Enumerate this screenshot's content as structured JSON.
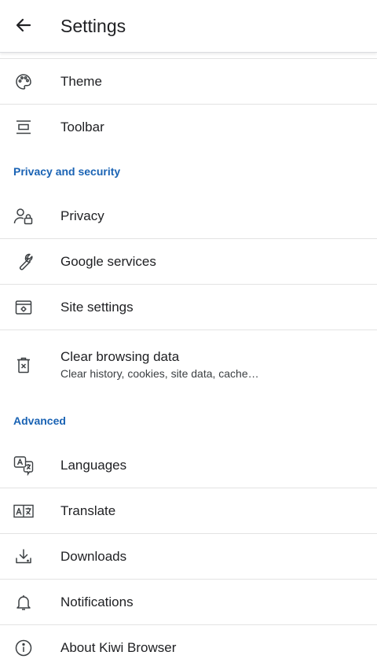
{
  "appbar": {
    "title": "Settings",
    "back_icon": "arrow-back-icon"
  },
  "sections": [
    {
      "items": [
        {
          "label": "Theme",
          "icon": "palette-icon"
        },
        {
          "label": "Toolbar",
          "icon": "toolbar-icon"
        }
      ]
    },
    {
      "header": "Privacy and security",
      "items": [
        {
          "label": "Privacy",
          "icon": "privacy-icon"
        },
        {
          "label": "Google services",
          "icon": "wrench-icon"
        },
        {
          "label": "Site settings",
          "icon": "site-settings-icon"
        },
        {
          "label": "Clear browsing data",
          "sublabel": "Clear history, cookies, site data, cache…",
          "icon": "trash-icon"
        }
      ]
    },
    {
      "header": "Advanced",
      "items": [
        {
          "label": "Languages",
          "icon": "languages-icon"
        },
        {
          "label": "Translate",
          "icon": "translate-icon"
        },
        {
          "label": "Downloads",
          "icon": "download-icon"
        },
        {
          "label": "Notifications",
          "icon": "bell-icon"
        },
        {
          "label": "About Kiwi Browser",
          "icon": "info-icon"
        }
      ]
    }
  ],
  "colors": {
    "section_header": "#1a63b4",
    "text": "#202124",
    "divider": "#e3e3e3"
  }
}
